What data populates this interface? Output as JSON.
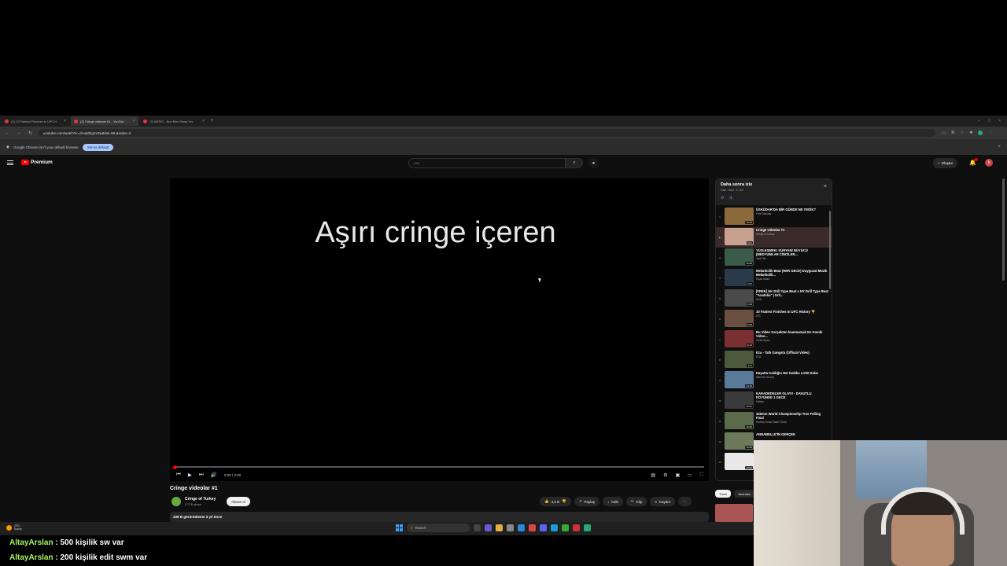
{
  "browser": {
    "tabs": [
      {
        "label": "(2) 10 Fastest Finishes in UFC H",
        "active": false
      },
      {
        "label": "(2) Cringe videolar #1 - YouTub",
        "active": true
      },
      {
        "label": "(2) MERO - Bon Bleri Sana Yer",
        "active": false
      }
    ],
    "url": "youtube.com/watch?v=dAoj8fsgXc3w&list=WL&index=2",
    "infobar_text": "Google Chrome isn't your default browser",
    "infobar_button": "Set as default"
  },
  "youtube": {
    "logo_text": "Premium",
    "search_placeholder": "Ara",
    "create_label": "Oluştur",
    "video": {
      "caption_text": "Aşırı cringe içeren",
      "time": "0:00 / 3:00",
      "progress": 0,
      "title": "Cringe videolar #1",
      "channel": "Cringe of Turkey",
      "subscribers": "3,72 B abone",
      "subscribe_label": "Abone ol",
      "likes": "4,5 B",
      "share_label": "Paylaş",
      "download_label": "İndir",
      "clip_label": "Klip",
      "save_label": "Kaydet",
      "description": "439 B görüntüleme  3 yıl önce"
    },
    "playlist": {
      "title": "Daha sonra izle",
      "subtitle": "Gizli · birol · 2 / 49",
      "items": [
        {
          "num": "1",
          "title": "ÜSKÜDAR'DA BİR GÜNDE NE YEDİK?",
          "channel": "Fırat Sobutay",
          "duration": "18:29",
          "color": "#8a6a3a"
        },
        {
          "num": "▶",
          "title": "Cringe videolar #1",
          "channel": "Cringe of Turkey",
          "duration": "3:01",
          "color": "#c8a090"
        },
        {
          "num": "3",
          "title": "YÜZLEŞMEK! SÜRYANİ BÜYÜCÜ (MEDYUMLAR CİNCİLER...",
          "channel": "Yedi Film",
          "duration": "26:08",
          "color": "#3a5a4a"
        },
        {
          "num": "4",
          "title": "Melankolik Beat (HER GECE) Duygusal Müzik Melankolik...",
          "channel": "Erşan Music",
          "duration": "3:51",
          "color": "#2a3a4a"
        },
        {
          "num": "5",
          "title": "[FREE] UK Drill Type Beat x NY Drill Type Beat \"Anatolia\" | Drll...",
          "channel": "NUA",
          "duration": "2:29",
          "color": "#4a4a4a"
        },
        {
          "num": "6",
          "title": "10 Fastest Finishes In UFC History 🏆",
          "channel": "UFC",
          "duration": "8:06",
          "color": "#6a5040"
        },
        {
          "num": "7",
          "title": "Bu Video Gerçekten İnanmamak En Komik Video...",
          "channel": "Zorluİzleyen",
          "duration": "11:22",
          "color": "#7a3030"
        },
        {
          "num": "8",
          "title": "Eza - Tatlı Gangsta (Official Video)",
          "channel": "EZA",
          "duration": "3:11",
          "color": "#4a5a3a"
        },
        {
          "num": "9",
          "title": "Hayatta Kaldığın Her Dakika 1.000 Dolar",
          "channel": "Mehmet Vanmış",
          "duration": "14:10",
          "color": "#5a7a9a"
        },
        {
          "num": "10",
          "title": "KARADEDELER OLAYI! - DAVUTLU KÖYÜNDE 1 GECE",
          "channel": "Kafalar",
          "duration": "22:51",
          "color": "#3a3a3a"
        },
        {
          "num": "11",
          "title": "325mm World Championship Tree Felling Final",
          "channel": "Rodney Rossi Easter Show",
          "duration": "10:30",
          "color": "#5a6a4a"
        },
        {
          "num": "12",
          "title": "ANNABELLE'İN GERÇEK",
          "channel": "",
          "duration": "12:56",
          "color": "#6a7a5a"
        },
        {
          "num": "13",
          "title": "",
          "channel": "",
          "duration": "10:00",
          "color": "#e8e8e8"
        }
      ]
    },
    "chips": [
      "Tümü",
      "Serinden"
    ]
  },
  "taskbar": {
    "weather_temp": "29°C",
    "weather_desc": "Sunny",
    "search_label": "Search"
  },
  "chat": [
    {
      "user": "AltayArslan",
      "message": ": 500 kişilik sw var"
    },
    {
      "user": "AltayArslan",
      "message": ": 200 kişilik edit swm var"
    }
  ]
}
